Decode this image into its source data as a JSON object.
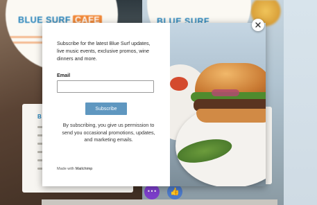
{
  "background": {
    "logo_left": {
      "brand": "BLUE SURF",
      "badge": "CAFE"
    },
    "logo_right": {
      "brand": "BLUE SURF"
    },
    "card_left_title_fragment": "B"
  },
  "modal": {
    "intro_text": "Subscribe for the latest Blue Surf updates, live music events, exclusive promos, wine dinners and more.",
    "email_label": "Email",
    "email_value": "",
    "subscribe_label": "Subscribe",
    "disclaimer": "By subscribing, you give us permission to send you occasional promotions, updates, and marketing emails.",
    "made_with_prefix": "Made with",
    "made_with_brand": "Mailchimp"
  },
  "icons": {
    "close": "close-icon",
    "more": "more-dots-icon",
    "like": "thumbs-up-icon"
  },
  "colors": {
    "brand_blue": "#1f7fb8",
    "cafe_orange": "#f28a3a",
    "subscribe_button": "#5f97c0",
    "dots_purple": "#7b3ec9",
    "like_blue": "#4b79c9"
  }
}
